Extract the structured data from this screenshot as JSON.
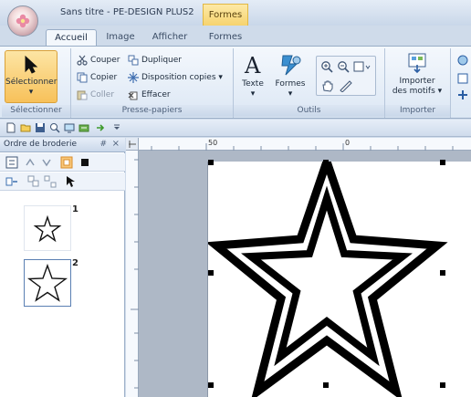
{
  "window": {
    "title": "Sans titre - PE-DESIGN PLUS2",
    "context_tab": "Formes"
  },
  "tabs": [
    {
      "label": "Accueil",
      "active": true
    },
    {
      "label": "Image",
      "active": false
    },
    {
      "label": "Afficher",
      "active": false
    },
    {
      "label": "Formes",
      "active": false
    }
  ],
  "ribbon": {
    "select": {
      "label": "Sélectionner",
      "group": "Sélectionner"
    },
    "clipboard": {
      "cut": "Couper",
      "copy": "Copier",
      "paste": "Coller",
      "duplicate": "Dupliquer",
      "copy_layout": "Disposition copies",
      "delete": "Effacer",
      "group": "Presse-papiers"
    },
    "tools": {
      "text": "Texte",
      "shapes": "Formes",
      "group": "Outils"
    },
    "import": {
      "label_line1": "Importer",
      "label_line2": "des motifs",
      "group": "Importer"
    }
  },
  "panel": {
    "title": "Ordre de broderie",
    "pin": "#",
    "close": "×",
    "items": [
      {
        "number": "1"
      },
      {
        "number": "2"
      }
    ]
  },
  "ruler": {
    "ticks": [
      "50",
      "0"
    ]
  },
  "colors": {
    "accent": "#f7c15a",
    "ribbon_bg": "#dce7f4",
    "workspace": "#aeb8c6"
  }
}
